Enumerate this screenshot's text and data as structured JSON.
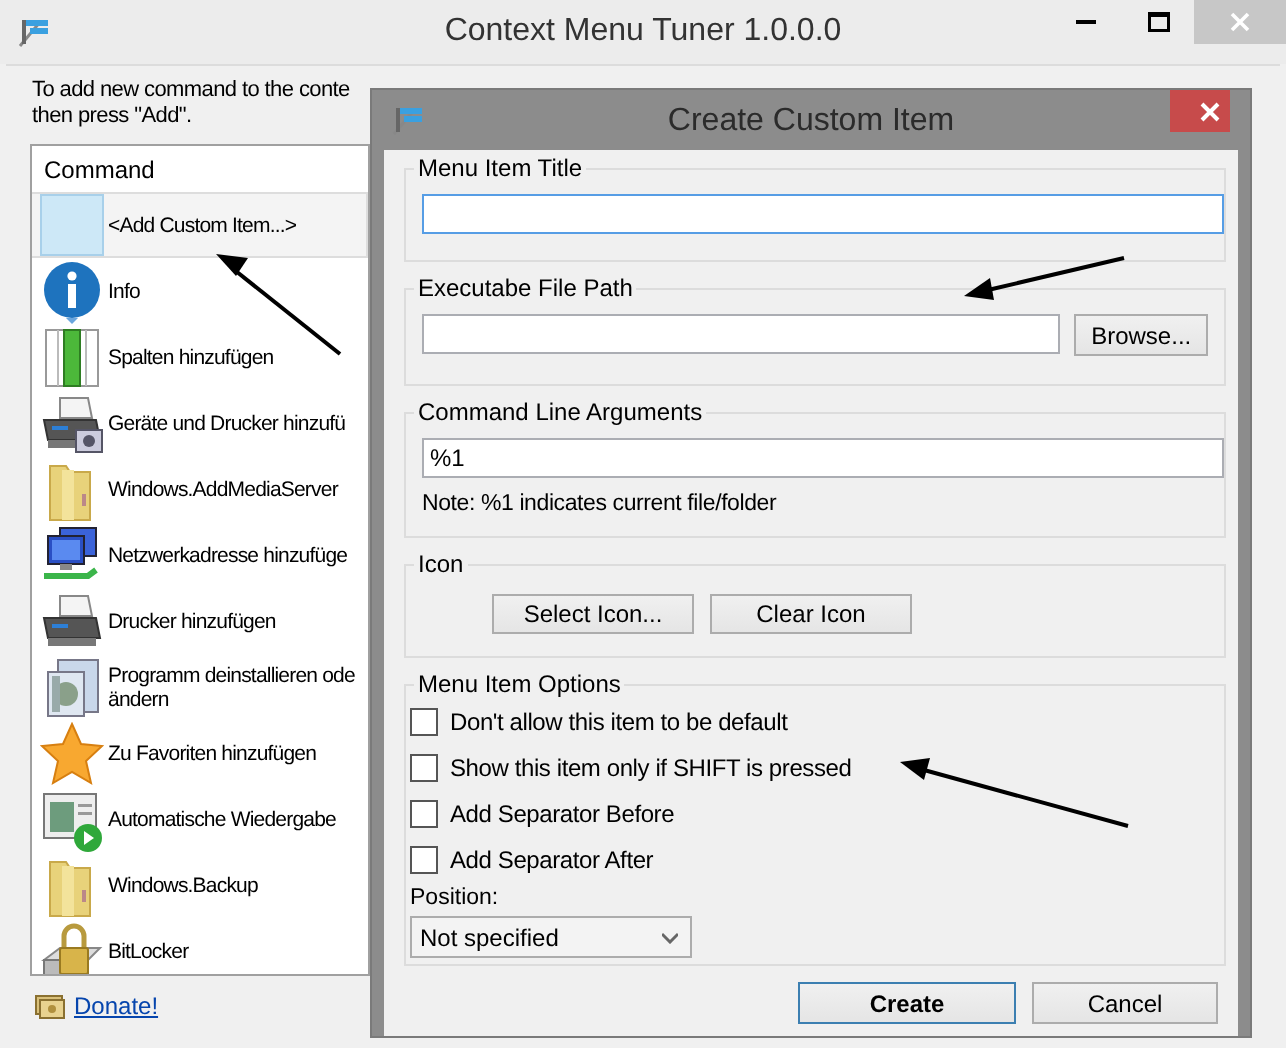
{
  "window": {
    "title": "Context Menu Tuner 1.0.0.0"
  },
  "instructions": [
    "To add new command to the conte",
    "then press \"Add\"."
  ],
  "command_list": {
    "header": "Command",
    "items": [
      {
        "label": "<Add Custom Item...>",
        "selected": true
      },
      {
        "label": "Info",
        "selected": false
      },
      {
        "label": "Spalten hinzufügen",
        "selected": false
      },
      {
        "label": "Geräte und Drucker hinzufü",
        "selected": false
      },
      {
        "label": "Windows.AddMediaServer",
        "selected": false
      },
      {
        "label": "Netzwerkadresse hinzufüge",
        "selected": false
      },
      {
        "label": "Drucker hinzufügen",
        "selected": false
      },
      {
        "label": "Programm deinstallieren ode\nändern",
        "selected": false
      },
      {
        "label": "Zu Favoriten hinzufügen",
        "selected": false
      },
      {
        "label": "Automatische Wiedergabe",
        "selected": false
      },
      {
        "label": "Windows.Backup",
        "selected": false
      },
      {
        "label": "BitLocker",
        "selected": false
      }
    ]
  },
  "donate_link": "Donate!",
  "dialog": {
    "title": "Create Custom Item",
    "menu_item_title": {
      "label": "Menu Item Title"
    },
    "executable_path": {
      "label": "Executabe File Path",
      "button": "Browse..."
    },
    "arguments": {
      "label": "Command Line Arguments",
      "value": "%1",
      "note": "Note: %1 indicates current file/folder"
    },
    "icon": {
      "label": "Icon",
      "buttons": [
        "Select Icon...",
        "Clear Icon"
      ]
    },
    "options": {
      "label": "Menu Item Options",
      "items": [
        {
          "label": "Don't allow this item to be default",
          "checked": false
        },
        {
          "label": "Show this item only if SHIFT is pressed",
          "checked": false
        },
        {
          "label": "Add Separator Before",
          "checked": false
        },
        {
          "label": "Add Separator After",
          "checked": false
        }
      ],
      "position_label": "Position:",
      "position_value": "Not specified"
    },
    "buttons": [
      {
        "label": "Create",
        "default": true
      },
      {
        "label": "Cancel",
        "default": false
      }
    ]
  }
}
